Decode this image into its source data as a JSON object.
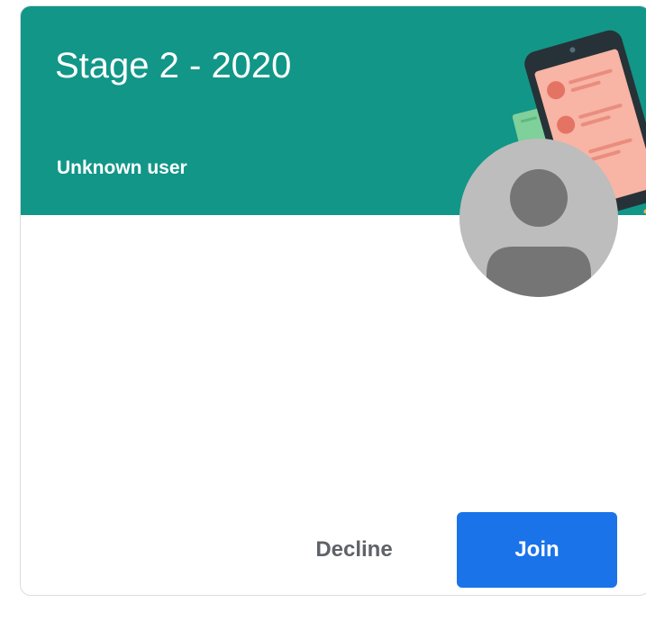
{
  "card": {
    "title": "Stage 2 - 2020",
    "owner": "Unknown user",
    "header_color": "#129688",
    "illustration_icon": "phone-illustration-icon",
    "avatar_icon": "default-avatar-icon"
  },
  "actions": {
    "decline_label": "Decline",
    "join_label": "Join",
    "join_color": "#1a73e8"
  }
}
